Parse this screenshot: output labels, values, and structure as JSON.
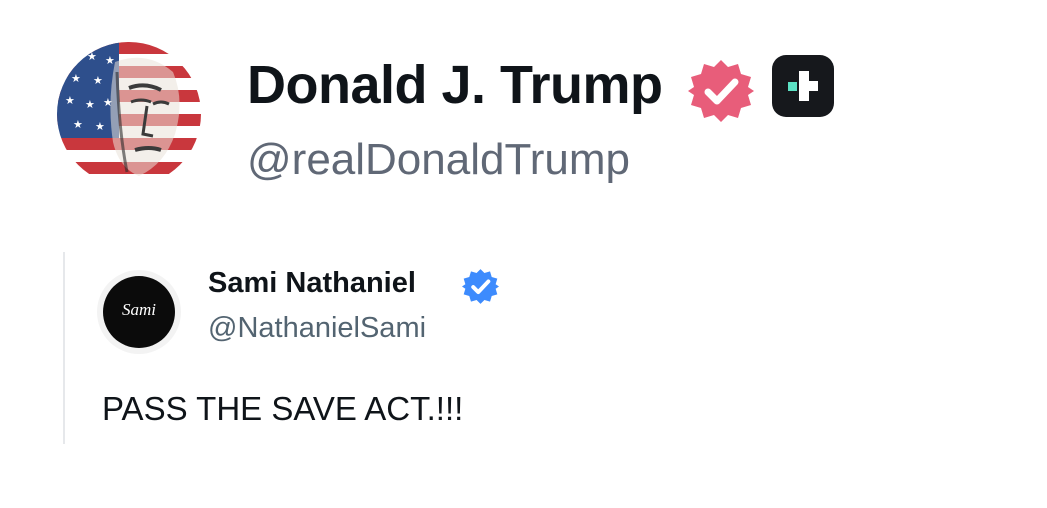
{
  "post": {
    "author": {
      "display_name": "Donald J. Trump",
      "handle": "@realDonaldTrump",
      "avatar_icon": "flag-portrait-avatar",
      "verified_color": "#e85d7a"
    },
    "platform_badge_icon": "truth-social-icon",
    "quote": {
      "author": {
        "display_name": "Sami Nathaniel",
        "handle": "@NathanielSami",
        "avatar_mark": "Sami",
        "verified_color": "#3d8bfd"
      },
      "text": "PASS THE SAVE ACT.!!!"
    }
  }
}
